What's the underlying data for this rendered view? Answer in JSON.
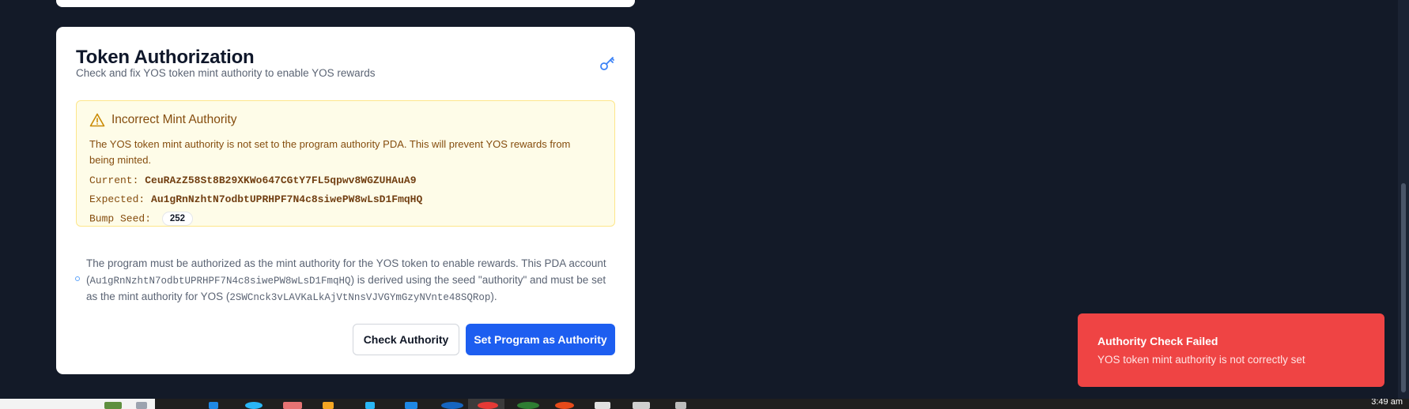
{
  "card": {
    "title": "Token Authorization",
    "subtitle": "Check and fix YOS token mint authority to enable YOS rewards",
    "icon": "key-icon"
  },
  "alert": {
    "icon": "warning-icon",
    "title": "Incorrect Mint Authority",
    "description": "The YOS token mint authority is not set to the program authority PDA. This will prevent YOS rewards from being minted.",
    "current_label": "Current:",
    "current_value": "CeuRAzZ58St8B29XKWo647CGtY7FL5qpwv8WGZUHAuA9",
    "expected_label": "Expected:",
    "expected_value": "Au1gRnNzhtN7odbtUPRHPF7N4c8siwePW8wLsD1FmqHQ",
    "bump_label": "Bump Seed:",
    "bump_value": "252"
  },
  "info": {
    "text_1": "The program must be authorized as the mint authority for the YOS token to enable rewards. This PDA account (",
    "pda": "Au1gRnNzhtN7odbtUPRHPF7N4c8siwePW8wLsD1FmqHQ",
    "text_2": ") is derived using the seed \"authority\" and must be set as the mint authority for YOS (",
    "mint": "2SWCnck3vLAVKaLkAjVtNnsVJVGYmGzyNVnte48SQRop",
    "text_3": ")."
  },
  "buttons": {
    "check": "Check Authority",
    "set": "Set Program as Authority"
  },
  "toast": {
    "title": "Authority Check Failed",
    "description": "YOS token mint authority is not correctly set"
  },
  "taskbar": {
    "clock": "3:49 am"
  },
  "colors": {
    "page_bg": "#131a28",
    "primary": "#1d5ef0",
    "toast_bg": "#ef4444",
    "alert_text": "#854d0e",
    "alert_bg": "#fefce8"
  }
}
